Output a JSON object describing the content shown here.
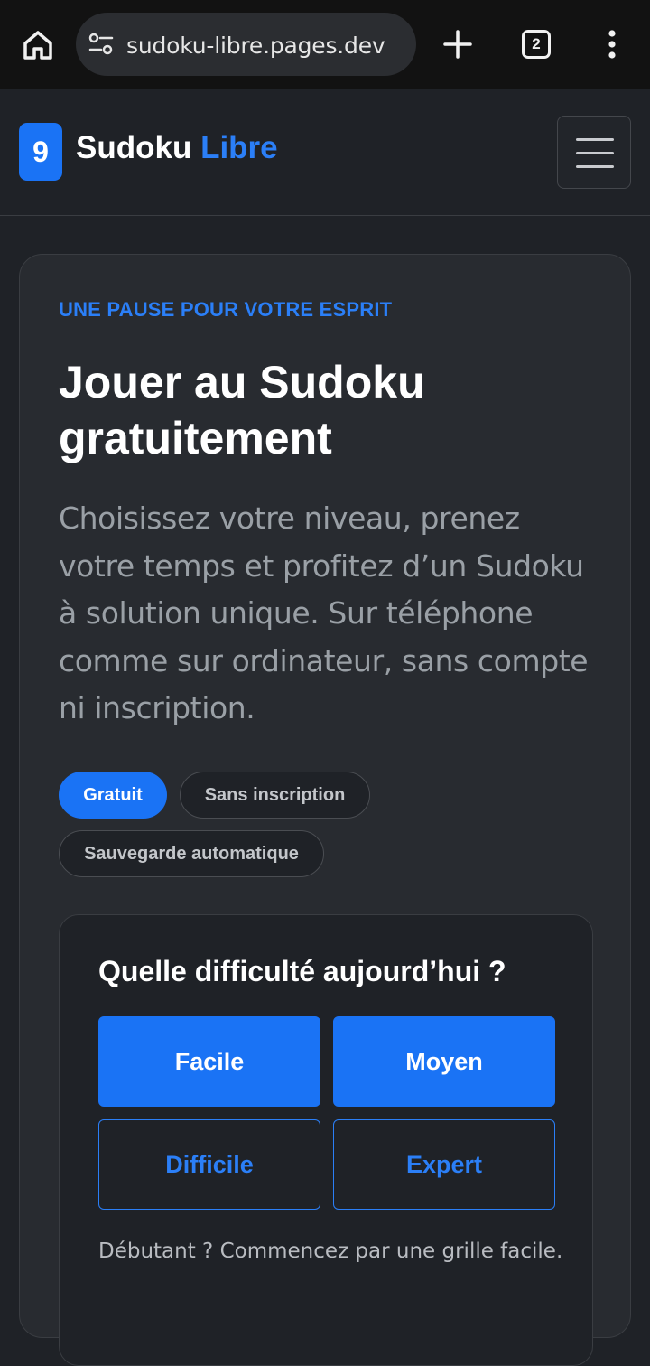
{
  "browser": {
    "url": "sudoku-libre.pages.dev",
    "tab_count": "2"
  },
  "header": {
    "logo_digit": "9",
    "brand_main": "Sudoku",
    "brand_accent": "Libre"
  },
  "hero": {
    "eyebrow": "UNE PAUSE POUR VOTRE ESPRIT",
    "title": "Jouer au Sudoku gratuitement",
    "description": "Choisissez votre niveau, prenez votre temps et profitez d’un Sudoku à solution unique. Sur téléphone comme sur ordinateur, sans compte ni inscription.",
    "chips": [
      "Gratuit",
      "Sans inscription",
      "Sauvegarde automatique"
    ]
  },
  "difficulty": {
    "title": "Quelle difficulté aujourd’hui ?",
    "levels": [
      "Facile",
      "Moyen",
      "Difficile",
      "Expert"
    ],
    "hint": "Débutant ? Commencez par une grille facile."
  },
  "colors": {
    "accent": "#1a73f5",
    "accent_text": "#2b7ff7",
    "background": "#1f2227",
    "card": "#282b30"
  },
  "icons": [
    "home-icon",
    "site-settings-icon",
    "new-tab-icon",
    "tab-switcher-icon",
    "more-options-icon",
    "hamburger-menu-icon"
  ]
}
